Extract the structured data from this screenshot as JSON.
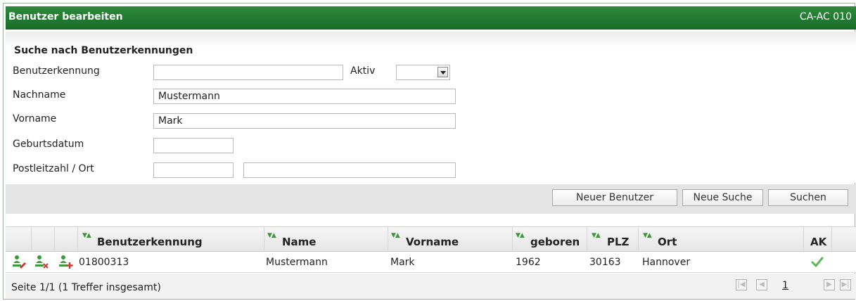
{
  "window": {
    "title": "Benutzer bearbeiten",
    "code": "CA-AC 010"
  },
  "search": {
    "section_title": "Suche nach Benutzerkennungen",
    "labels": {
      "benutzerkennung": "Benutzerkennung",
      "aktiv": "Aktiv",
      "nachname": "Nachname",
      "vorname": "Vorname",
      "geburtsdatum": "Geburtsdatum",
      "plz_ort": "Postleitzahl / Ort"
    },
    "values": {
      "benutzerkennung": "",
      "aktiv": "",
      "nachname": "Mustermann",
      "vorname": "Mark",
      "geburtsdatum": "",
      "plz": "",
      "ort": ""
    }
  },
  "buttons": {
    "new_user": "Neuer Benutzer",
    "new_search": "Neue Suche",
    "search": "Suchen"
  },
  "table": {
    "columns": [
      "Benutzerkennung",
      "Name",
      "Vorname",
      "geboren",
      "PLZ",
      "Ort",
      "AK"
    ],
    "rows": [
      {
        "benutzerkennung": "01800313",
        "name": "Mustermann",
        "vorname": "Mark",
        "geboren": "1962",
        "plz": "30163",
        "ort": "Hannover",
        "ak": true
      }
    ],
    "sort_icon": "sort-arrows-icon"
  },
  "pagination": {
    "info": "Seite 1/1 (1 Treffer insgesamt)",
    "current_page": "1"
  },
  "colors": {
    "titlebar": "#237a31",
    "check": "#5cb85c",
    "row_icon_green": "#3b9b3b",
    "row_icon_red": "#d0342c"
  }
}
